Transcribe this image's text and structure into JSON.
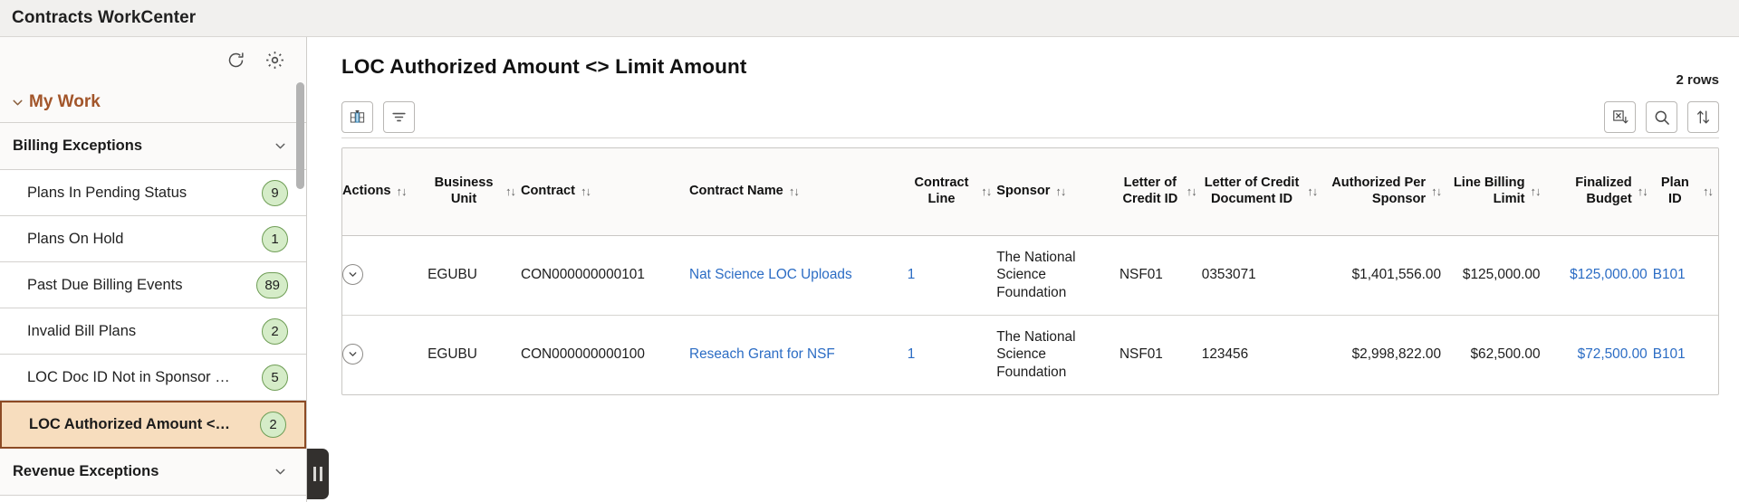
{
  "app": {
    "title": "Contracts WorkCenter"
  },
  "sidebar": {
    "toolbar": [
      {
        "icon": "refresh-icon",
        "name": "refresh-button"
      },
      {
        "icon": "gear-icon",
        "name": "settings-button"
      }
    ],
    "my_work": {
      "label": "My Work",
      "caret": "chevron-down-icon"
    },
    "groups": [
      {
        "label": "Billing Exceptions",
        "caret": "chevron-down-icon",
        "items": [
          {
            "label": "Plans In Pending Status",
            "badge": "9",
            "selected": false
          },
          {
            "label": "Plans On Hold",
            "badge": "1",
            "selected": false
          },
          {
            "label": "Past Due Billing Events",
            "badge": "89",
            "selected": false
          },
          {
            "label": "Invalid Bill Plans",
            "badge": "2",
            "selected": false
          },
          {
            "label": "LOC Doc ID Not in Sponsor …",
            "badge": "5",
            "selected": false
          },
          {
            "label": "LOC Authorized Amount <…",
            "badge": "2",
            "selected": true
          }
        ]
      },
      {
        "label": "Revenue Exceptions",
        "caret": "chevron-down-icon",
        "items": []
      }
    ],
    "collapse_handle": "pause-bars-icon"
  },
  "main": {
    "title": "LOC Authorized Amount <> Limit Amount",
    "rows_count": "2 rows",
    "toolbar_left": [
      {
        "name": "chart-view-button",
        "icon": "bar-chart-icon"
      },
      {
        "name": "filter-button",
        "icon": "filter-icon"
      }
    ],
    "toolbar_right": [
      {
        "name": "export-excel-button",
        "icon": "excel-download-icon"
      },
      {
        "name": "search-button",
        "icon": "search-icon"
      },
      {
        "name": "sort-button",
        "icon": "sort-updown-icon"
      }
    ],
    "table": {
      "sort_icon": "↑↓",
      "row_action_icon": "chevron-down-circle-icon",
      "columns": [
        {
          "label": "Actions",
          "align": "left"
        },
        {
          "label": "Business Unit",
          "align": "left"
        },
        {
          "label": "Contract",
          "align": "left"
        },
        {
          "label": "Contract Name",
          "align": "left"
        },
        {
          "label": "Contract Line",
          "align": "left"
        },
        {
          "label": "Sponsor",
          "align": "left"
        },
        {
          "label": "Letter of Credit ID",
          "align": "left"
        },
        {
          "label": "Letter of Credit Document ID",
          "align": "left"
        },
        {
          "label": "Authorized Per Sponsor",
          "align": "right"
        },
        {
          "label": "Line Billing Limit",
          "align": "right"
        },
        {
          "label": "Finalized Budget",
          "align": "right"
        },
        {
          "label": "Plan ID",
          "align": "left"
        }
      ],
      "rows": [
        {
          "business_unit": "EGUBU",
          "contract": "CON000000000101",
          "contract_name": "Nat Science LOC Uploads",
          "contract_line": "1",
          "sponsor": "The National Science Foundation",
          "loc_id": "NSF01",
          "loc_doc_id": "0353071",
          "authorized_per_sponsor": "$1,401,556.00",
          "line_billing_limit": "$125,000.00",
          "finalized_budget": "$125,000.00",
          "plan_id": "B101"
        },
        {
          "business_unit": "EGUBU",
          "contract": "CON000000000100",
          "contract_name": "Reseach Grant for NSF",
          "contract_line": "1",
          "sponsor": "The National Science Foundation",
          "loc_id": "NSF01",
          "loc_doc_id": "123456",
          "authorized_per_sponsor": "$2,998,822.00",
          "line_billing_limit": "$62,500.00",
          "finalized_budget": "$72,500.00",
          "plan_id": "B101"
        }
      ]
    }
  },
  "colors": {
    "accent_brown": "#a2552a",
    "selected_row_bg": "#f7ddbe",
    "selected_row_border": "#8c4a24",
    "badge_bg": "#d5ecc8",
    "badge_border": "#6f9e56",
    "link_blue": "#2b6cc4",
    "header_bg": "#f1f0ee"
  }
}
